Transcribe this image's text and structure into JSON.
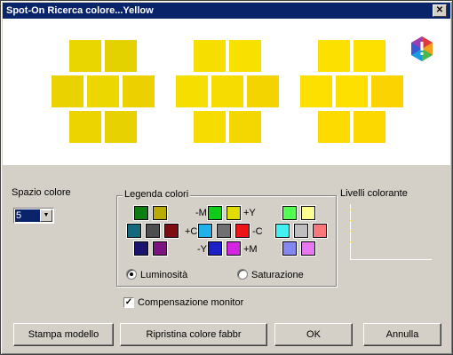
{
  "window": {
    "title": "Spot-On Ricerca colore...Yellow",
    "close_glyph": "✕"
  },
  "preview": {
    "groups": [
      {
        "colors": [
          "#e9d500",
          "#e4d200",
          "#ead200",
          "#ecd800",
          "#ecd000",
          "#ebd400",
          "#e7d100"
        ]
      },
      {
        "colors": [
          "#f6df00",
          "#f8e000",
          "#f6de00",
          "#f7dc00",
          "#f4d400",
          "#f6dc00",
          "#f4d600"
        ]
      },
      {
        "colors": [
          "#fbe000",
          "#fde000",
          "#fde000",
          "#fde000",
          "#fbd400",
          "#fdda00",
          "#fcd800"
        ]
      }
    ]
  },
  "color_space": {
    "label": "Spazio colore",
    "value": "5"
  },
  "legend": {
    "title": "Legenda colori",
    "minus_m": "-M",
    "plus_y": "+Y",
    "plus_c": "+C",
    "minus_c": "-C",
    "minus_y": "-Y",
    "plus_m": "+M",
    "swatches": {
      "row1": [
        "#0b7d12",
        "#b8ac00",
        "#10cb18",
        "#dedc00",
        "#52ff52",
        "#ffff90"
      ],
      "row2": [
        "#146a7c",
        "#4e4e4e",
        "#7d0c10",
        "#21b1ea",
        "#707070",
        "#ec1414",
        "#42f0f2",
        "#bebebe",
        "#f8787c"
      ],
      "row3": [
        "#1a1470",
        "#7c1480",
        "#1b20c8",
        "#d426e0",
        "#8488f4",
        "#e678f2"
      ]
    },
    "radio_luminosity": "Luminosità",
    "radio_saturation": "Saturazione"
  },
  "ink_levels": {
    "label": "Livelli colorante"
  },
  "monitor_compensation": {
    "label": "Compensazione monitor",
    "checked": true,
    "check_glyph": "✓"
  },
  "buttons": {
    "print": "Stampa modello",
    "reset": "Ripristina colore fabbr",
    "ok": "OK",
    "cancel": "Annulla"
  }
}
